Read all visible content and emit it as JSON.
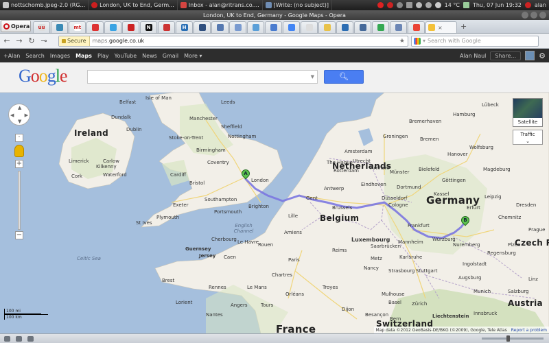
{
  "taskbar": {
    "tasks": [
      {
        "label": "nottschomb.jpeg-2.0 (RG...",
        "color": "#c8c8c8"
      },
      {
        "label": "London, UK to End, Germ...",
        "color": "#cc1f1f"
      },
      {
        "label": "Inbox - alan@ritrans.co....",
        "color": "#d64541"
      },
      {
        "label": "[Write: (no subject)]",
        "color": "#6f8db4"
      }
    ],
    "weather": "14 °C",
    "clock": "Thu, 07 Jun  19:32",
    "user": "alan"
  },
  "window": {
    "title": "London, UK to End, Germany - Google Maps - Opera"
  },
  "browser": {
    "menu_label": "Opera",
    "tabs": [
      {
        "icon": "uu-icon",
        "text": "uu",
        "color": "#ddd"
      },
      {
        "icon": "site-icon",
        "text": "",
        "color": "#3a8ab5"
      },
      {
        "icon": "mt-icon",
        "text": "mt",
        "color": "#fff"
      },
      {
        "icon": "pdf-icon",
        "text": "",
        "color": "#d33"
      },
      {
        "icon": "twitter-icon",
        "text": "",
        "color": "#3aa3e3"
      },
      {
        "icon": "site-icon",
        "text": "",
        "color": "#c22"
      },
      {
        "icon": "n-icon",
        "text": "N",
        "color": "#111"
      },
      {
        "icon": "site-icon",
        "text": "",
        "color": "#c33"
      },
      {
        "icon": "h-icon",
        "text": "H",
        "color": "#2a6fb5"
      },
      {
        "icon": "site-icon",
        "text": "",
        "color": "#2f4f7f"
      },
      {
        "icon": "site-icon",
        "text": "",
        "color": "#5578b0"
      },
      {
        "icon": "site-icon",
        "text": "",
        "color": "#7a9bd0"
      },
      {
        "icon": "site-icon",
        "text": "",
        "color": "#5a9fd8"
      },
      {
        "icon": "site-icon",
        "text": "",
        "color": "#4a7ccf"
      },
      {
        "icon": "google-icon",
        "text": "",
        "color": "#4285f4"
      },
      {
        "icon": "site-icon",
        "text": "",
        "color": "#ddd"
      },
      {
        "icon": "pencil-icon",
        "text": "",
        "color": "#e8c24a"
      },
      {
        "icon": "site-icon",
        "text": "",
        "color": "#2b6db3"
      },
      {
        "icon": "site-icon",
        "text": "",
        "color": "#466a9a"
      },
      {
        "icon": "google-icon",
        "text": "",
        "color": "#34a853"
      },
      {
        "icon": "site-icon",
        "text": "",
        "color": "#6b86b5"
      },
      {
        "icon": "google-icon",
        "text": "",
        "color": "#ea4335"
      }
    ],
    "active_tab_icon_color": "#f3c13a",
    "address": {
      "secure_label": "Secure",
      "url_prefix": "maps.",
      "url_domain": "google.co.uk"
    },
    "search_placeholder": "Search with Google"
  },
  "gbar": {
    "items": [
      "+Alan",
      "Search",
      "Images",
      "Maps",
      "Play",
      "YouTube",
      "News",
      "Gmail",
      "More ▾"
    ],
    "active": "Maps",
    "user_name": "Alan Naul",
    "share_label": "Share..."
  },
  "gheader": {
    "logo_letters": [
      "G",
      "o",
      "o",
      "g",
      "l",
      "e"
    ],
    "search_value": "",
    "search_button_icon": "magnifier-icon"
  },
  "map": {
    "countries": [
      {
        "name": "Ireland",
        "key": "ireland"
      },
      {
        "name": "Netherlands",
        "key": "netherlands"
      },
      {
        "name": "Belgium",
        "key": "belgium"
      },
      {
        "name": "Germany",
        "key": "germany"
      },
      {
        "name": "Luxembourg",
        "key": "luxembourg"
      },
      {
        "name": "Czech R",
        "key": "czech"
      },
      {
        "name": "Austria",
        "key": "austria"
      },
      {
        "name": "Switzerland",
        "key": "switzerland"
      },
      {
        "name": "France",
        "key": "france"
      },
      {
        "name": "Guernsey",
        "key": "guernsey"
      },
      {
        "name": "Jersey",
        "key": "jersey"
      },
      {
        "name": "Liechtenstein",
        "key": "liechtenstein"
      }
    ],
    "cities": [
      "Isle of Man",
      "Belfast",
      "Dundalk",
      "Dublin",
      "Carlow",
      "Waterford",
      "Limerick",
      "Cork",
      "Kilkenny",
      "Manchester",
      "Sheffield",
      "Stoke-on-Trent",
      "Nottingham",
      "Leeds",
      "Birmingham",
      "Coventry",
      "London",
      "Bristol",
      "Cardiff",
      "Southampton",
      "Portsmouth",
      "Brighton",
      "Exeter",
      "Plymouth",
      "St Ives",
      "Groningen",
      "Bremerhaven",
      "Hamburg",
      "Lübeck",
      "Bremen",
      "Hanover",
      "Magdeburg",
      "Bielefeld",
      "Dortmund",
      "Münster",
      "Düsseldorf",
      "Cologne",
      "Frankfurt",
      "Nuremberg",
      "Leipzig",
      "Dresden",
      "Erfurt",
      "Kassel",
      "Göttingen",
      "Wolfsburg",
      "Munich",
      "Augsburg",
      "Stuttgart",
      "Ingolstadt",
      "Regensburg",
      "Antwerp",
      "Gent",
      "Brussels",
      "Lille",
      "Amiens",
      "Rouen",
      "Le Havre",
      "Caen",
      "Paris",
      "Reims",
      "Metz",
      "Nancy",
      "Strasbourg",
      "Karlsruhe",
      "Mannheim",
      "Le Mans",
      "Rennes",
      "Brest",
      "Orléans",
      "Tours",
      "Dijon",
      "Besançon",
      "Basel",
      "Zürich",
      "Bern",
      "Innsbruck",
      "Salzburg",
      "Plzen",
      "Prague",
      "Linz",
      "Chemnitz",
      "Würzburg",
      "Saarbrücken",
      "Mulhouse",
      "Nantes",
      "Angers",
      "Chartres",
      "Troyes",
      "Lorient",
      "Cherbourg",
      "Amsterdam",
      "Rotterdam",
      "Eindhoven",
      "The Hague",
      "Arnhem",
      "Utrecht"
    ],
    "water": [
      "Celtic Sea",
      "English Channel"
    ],
    "route_start": "A",
    "route_end": "B",
    "sat_label": "Satellite",
    "traffic_label": "Traffic",
    "scale_mi": "100 mi",
    "scale_km": "100 km",
    "attribution": "Map data ©2012 GeoBasis-DE/BKG (©2009), Google, Tele Atlas",
    "report_label": "Report a problem"
  },
  "colors": {
    "route": "#7b77e0",
    "land": "#f2efe8",
    "water": "#a5bfdd",
    "green": "#cfe1b6",
    "road": "#f0d57a"
  }
}
